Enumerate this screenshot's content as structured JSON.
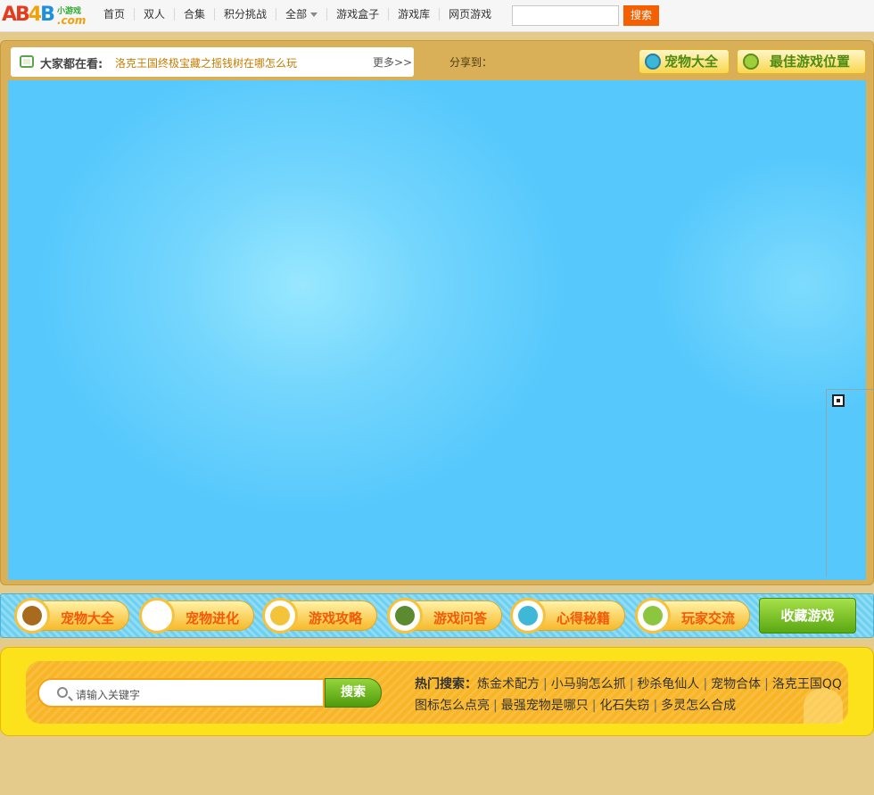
{
  "logo": {
    "text_a": "AB",
    "text_b": "4",
    "text_c": "B",
    "sub1": "小游戏",
    "sub2": ".com"
  },
  "nav": {
    "items": [
      "首页",
      "双人",
      "合集",
      "积分挑战",
      "全部",
      "游戏盒子",
      "游戏库",
      "网页游戏"
    ],
    "search_placeholder": "",
    "search_button": "搜索"
  },
  "watching": {
    "label": "大家都在看:",
    "text": "洛克王国终极宝藏之摇钱树在哪怎么玩",
    "more": "更多>>"
  },
  "share_label": "分享到：",
  "top_buttons": [
    "宠物大全",
    "最佳游戏位置"
  ],
  "menu": {
    "items": [
      "宠物大全",
      "宠物进化",
      "游戏攻略",
      "游戏问答",
      "心得秘籍",
      "玩家交流"
    ],
    "favorite": "收藏游戏",
    "avatar_colors": [
      "#a86a1c",
      "#ffffff",
      "#f3c43a",
      "#5c8a2e",
      "#3fb8d8",
      "#8cc63f"
    ]
  },
  "bottom_search": {
    "placeholder": "请输入关键字",
    "button": "搜索",
    "hot_label": "热门搜索：",
    "hot_keywords": [
      "炼金术配方",
      "小马驹怎么抓",
      "秒杀龟仙人",
      "宠物合体",
      "洛克王国QQ图标怎么点亮",
      "最强宠物是哪只",
      "化石失窃",
      "多灵怎么合成"
    ]
  }
}
